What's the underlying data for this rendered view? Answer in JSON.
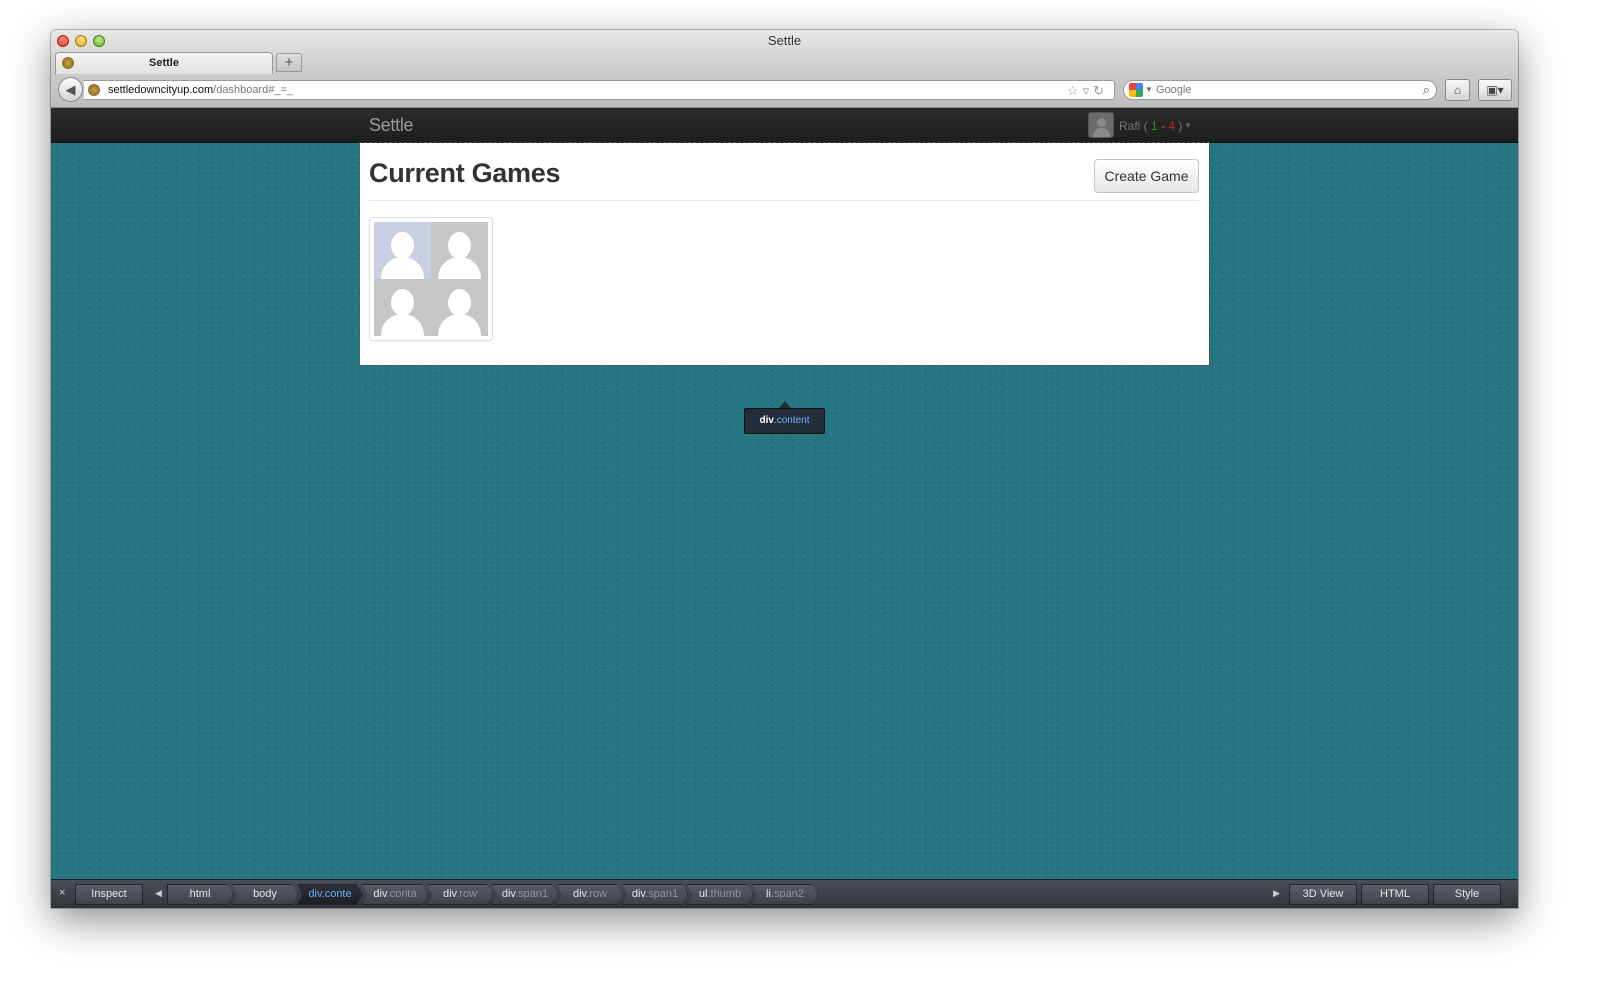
{
  "window": {
    "title": "Settle"
  },
  "tab": {
    "label": "Settle",
    "new_tab_label": "+"
  },
  "addressbar": {
    "host": "settledowncityup.com",
    "path": "/dashboard#_=_"
  },
  "searchbar": {
    "placeholder": "Google"
  },
  "navbar": {
    "brand": "Settle",
    "user_name": "Rafi",
    "open_paren": " ( ",
    "wins": "1",
    "separator": " - ",
    "losses": "4",
    "close_paren": " )"
  },
  "content": {
    "heading": "Current Games",
    "create_button": "Create Game"
  },
  "tooltip": {
    "tag": "div",
    "class": ".content"
  },
  "inspector": {
    "close_label": "×",
    "inspect_label": "Inspect",
    "breadcrumbs": [
      {
        "tag": "html",
        "cls": ""
      },
      {
        "tag": "body",
        "cls": ""
      },
      {
        "tag": "div",
        "cls": ".conte"
      },
      {
        "tag": "div",
        "cls": ".conta"
      },
      {
        "tag": "div",
        "cls": ".row"
      },
      {
        "tag": "div",
        "cls": ".span1"
      },
      {
        "tag": "div",
        "cls": ".row"
      },
      {
        "tag": "div",
        "cls": ".span1"
      },
      {
        "tag": "ul",
        "cls": ".thumb"
      },
      {
        "tag": "li",
        "cls": ".span2"
      }
    ],
    "view3d_label": "3D View",
    "html_label": "HTML",
    "style_label": "Style"
  },
  "colors": {
    "page_background": "#257583",
    "navbar": "#222222",
    "wins": "#2e8b2e",
    "losses": "#c0271f",
    "selected_crumb": "#5fb2ff"
  }
}
